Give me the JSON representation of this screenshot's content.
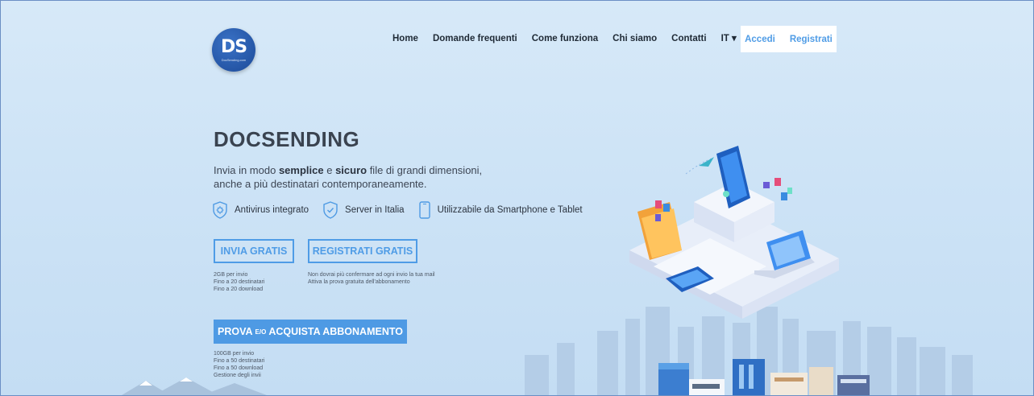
{
  "brand": {
    "logo_mono": "DS",
    "logo_small": "DocSending.com"
  },
  "nav": {
    "items": [
      "Home",
      "Domande frequenti",
      "Come funziona",
      "Chi siamo",
      "Contatti",
      "IT ▾"
    ]
  },
  "auth": {
    "login": "Accedi",
    "register": "Registrati"
  },
  "hero": {
    "title": "DOCSENDING",
    "lead": {
      "p1": "Invia in modo ",
      "b1": "semplice",
      "p2": " e ",
      "b2": "sicuro",
      "p3": " file di grandi dimensioni,",
      "line2": "anche a più destinatari contemporaneamente."
    },
    "features": [
      "Antivirus integrato",
      "Server in Italia",
      "Utilizzabile da Smartphone e Tablet"
    ],
    "btn_invia": "INVIA GRATIS",
    "btn_registrati": "REGISTRATI GRATIS",
    "note_invia": [
      "2GB per invio",
      "Fino a 20 destinatari",
      "Fino a 20 download"
    ],
    "note_registrati": [
      "Non dovrai più confermare ad ogni invio la tua mail",
      "Attiva la prova gratuita dell'abbonamento"
    ],
    "btn_abbonamento": {
      "pre": "PROVA",
      "mid": "E/O",
      "post": "ACQUISTA ABBONAMENTO"
    },
    "note_abbonamento": [
      "100GB per invio",
      "Fino a 50 destinatari",
      "Fino a 50 download",
      "Gestione degli invii"
    ]
  },
  "colors": {
    "accent": "#4e9ae4",
    "logo": "#1c4a98",
    "bg": "#cde3f6"
  }
}
